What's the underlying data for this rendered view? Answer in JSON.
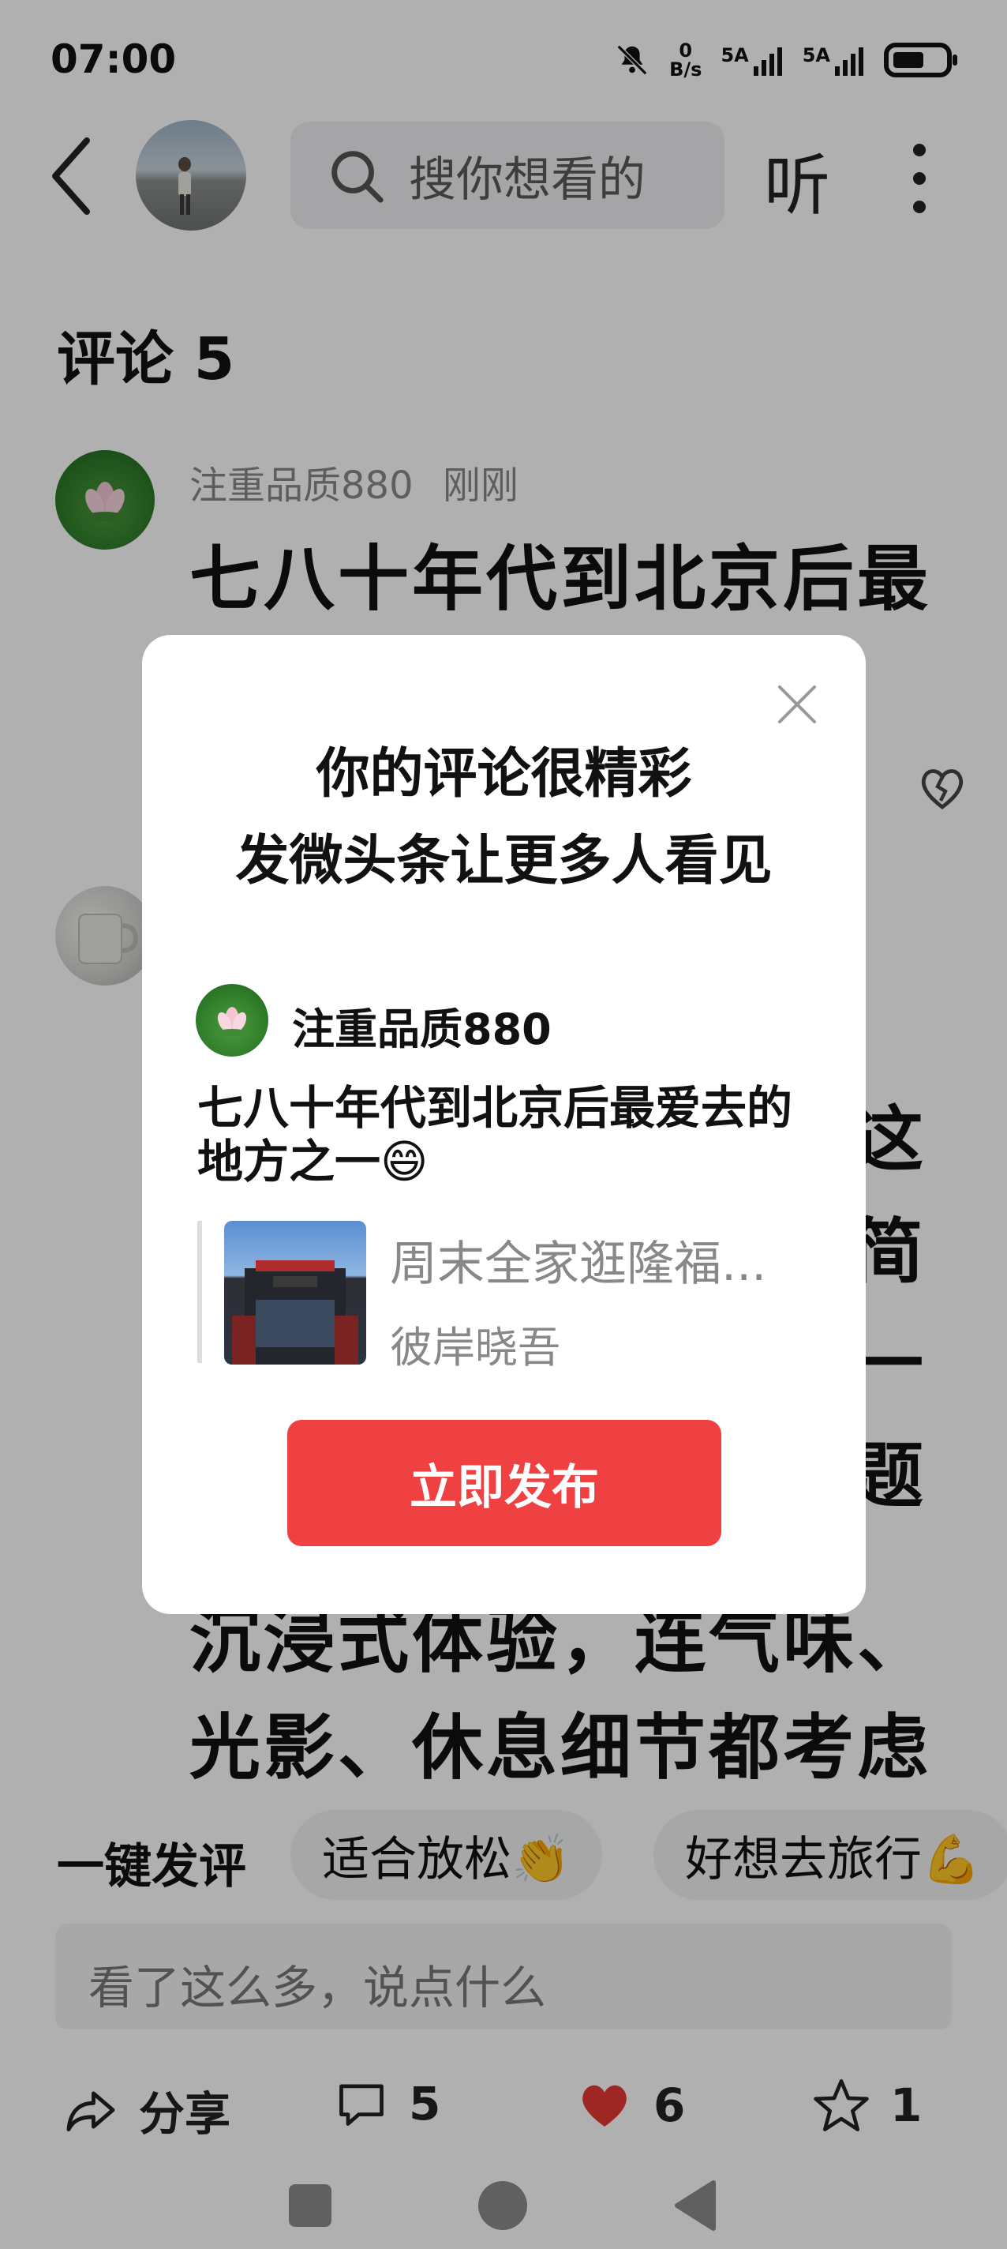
{
  "status_bar": {
    "time": "07:00",
    "net_speed_value": "0",
    "net_speed_unit": "B/s",
    "signal1": "5A",
    "signal2": "5A"
  },
  "header": {
    "search_placeholder": "搜你想看的",
    "listen_label": "听"
  },
  "comments": {
    "title": "评论 5",
    "first": {
      "user": "注重品质880",
      "time": "刚刚",
      "text_line1": "七八十年代到北京后最"
    },
    "second_visible_lines": [
      "这",
      "简",
      "一",
      "题",
      "沉浸式体验，连气味、",
      "光影、休息细节都考虑"
    ]
  },
  "quick_comment": {
    "label": "一键发评",
    "chips": [
      "适合放松👏",
      "好想去旅行💪"
    ]
  },
  "input": {
    "placeholder": "看了这么多，说点什么"
  },
  "bottom_bar": {
    "share_label": "分享",
    "comment_count": "5",
    "like_count": "6",
    "favorite_count": "1"
  },
  "modal": {
    "title_line1": "你的评论很精彩",
    "title_line2": "发微头条让更多人看见",
    "user": "注重品质880",
    "comment": "七八十年代到北京后最爱去的地方之一😄",
    "article_title": "周末全家逛隆福...",
    "article_author": "彼岸晓吾",
    "publish_button": "立即发布"
  },
  "colors": {
    "accent_red": "#f04142",
    "like_red": "#e53935",
    "overlay": "rgba(0,0,0,0.31)"
  }
}
